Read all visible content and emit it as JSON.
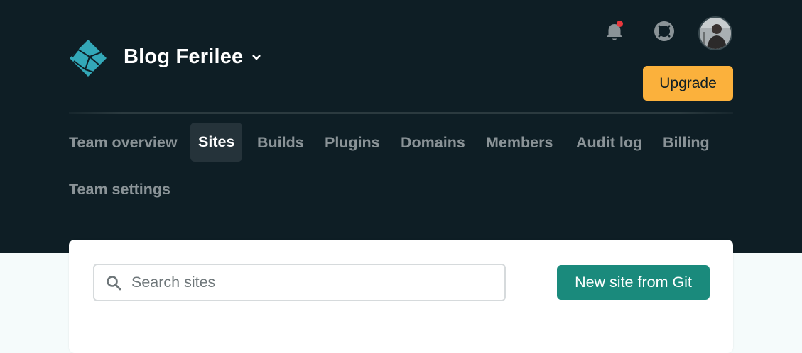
{
  "header": {
    "team_name": "Blog Ferilee",
    "upgrade_label": "Upgrade",
    "notification_dot_color": "#e8383d",
    "logo_color": "#33a8b8"
  },
  "nav": {
    "items": [
      {
        "label": "Team overview",
        "active": false
      },
      {
        "label": "Sites",
        "active": true
      },
      {
        "label": "Builds",
        "active": false
      },
      {
        "label": "Plugins",
        "active": false
      },
      {
        "label": "Domains",
        "active": false
      },
      {
        "label": "Members",
        "active": false
      },
      {
        "label": "Audit log",
        "active": false
      },
      {
        "label": "Billing",
        "active": false
      },
      {
        "label": "Team settings",
        "active": false
      }
    ]
  },
  "sites": {
    "search_placeholder": "Search sites",
    "search_value": "",
    "new_site_label": "New site from Git"
  },
  "colors": {
    "header_bg": "#0e1e25",
    "accent_teal": "#1a8a7c",
    "upgrade_yellow": "#fbb13c"
  }
}
